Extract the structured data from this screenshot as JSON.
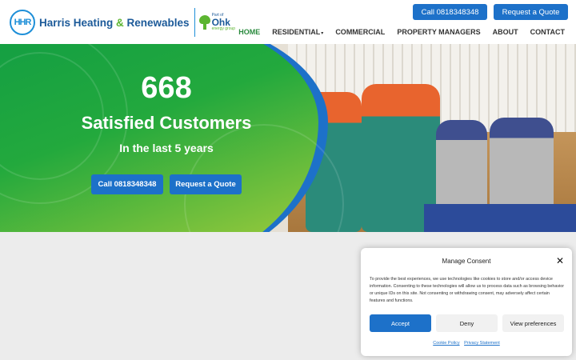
{
  "brand": {
    "logo_mark": "HHR",
    "name_part1": "Harris Heating ",
    "name_amp": "&",
    "name_part2": " Renewables",
    "ohk_small": "Part of",
    "ohk_big": "Ohk",
    "ohk_sub": "energy group"
  },
  "header": {
    "call_label": "Call 0818348348",
    "quote_label": "Request a Quote"
  },
  "nav": {
    "items": [
      {
        "label": "HOME",
        "active": true
      },
      {
        "label": "RESIDENTIAL",
        "has_dropdown": true
      },
      {
        "label": "COMMERCIAL"
      },
      {
        "label": "PROPERTY MANAGERS"
      },
      {
        "label": "ABOUT"
      },
      {
        "label": "CONTACT"
      }
    ],
    "dropdown_icon": "chevron-down-icon"
  },
  "hero": {
    "number": "668",
    "title": "Satisfied Customers",
    "subtitle": "In the last 5 years",
    "call_label": "Call 0818348348",
    "quote_label": "Request a Quote"
  },
  "consent": {
    "title": "Manage Consent",
    "close_icon": "close-icon",
    "body": "To provide the best experiences, we use technologies like cookies to store and/or access device information. Consenting to these technologies will allow us to process data such as browsing behavior or unique IDs on this site. Not consenting or withdrawing consent, may adversely affect certain features and functions.",
    "accept_label": "Accept",
    "deny_label": "Deny",
    "view_label": "View preferences",
    "cookie_policy": "Cookie Policy",
    "privacy_statement": "Privacy Statement"
  },
  "colors": {
    "primary_blue": "#1d71c9",
    "brand_green": "#2a8a3e",
    "hero_green": "#23a93d"
  }
}
